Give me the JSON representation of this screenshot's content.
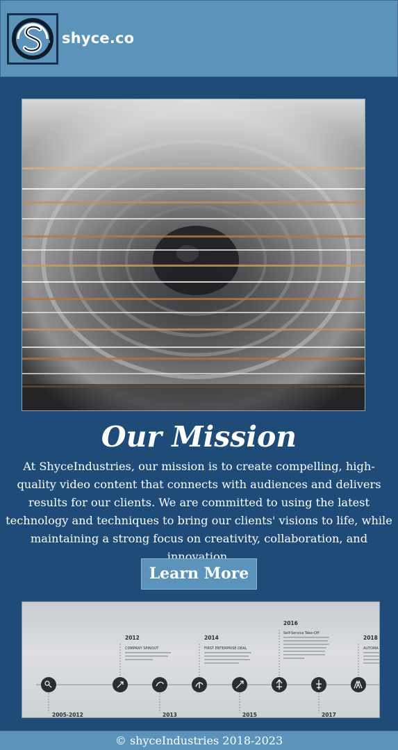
{
  "header": {
    "brand": "shyce.co",
    "logo_icon": "shyce-s-logo-icon"
  },
  "hero": {
    "image_icon": "camera-lens-motion-image"
  },
  "mission": {
    "title": "Our Mission",
    "text": "At ShyceIndustries, our mission is to create compelling, high-quality video content that connects with audiences and delivers results for our clients. We are committed to using the latest technology and techniques to bring our clients' visions to life, while maintaining a strong focus on creativity, collaboration, and innovation.",
    "button_label": "Learn More"
  },
  "timeline": {
    "events": [
      {
        "year": "2012",
        "title": "COMPANY SPINOUT"
      },
      {
        "year": "2014",
        "title": "FIRST ENTERPRISE DEAL"
      },
      {
        "year": "2016",
        "title": "Self-Service Take-Off"
      },
      {
        "year": "2018",
        "title": "AUTOMA"
      }
    ],
    "bottom_years": [
      "2005-2012",
      "2013",
      "2015",
      "2017"
    ]
  },
  "footer": {
    "copyright": "© shyceIndustries 2018-2023"
  },
  "colors": {
    "background": "#1f4b79",
    "header": "#5b93bb",
    "text": "#ffffff"
  }
}
